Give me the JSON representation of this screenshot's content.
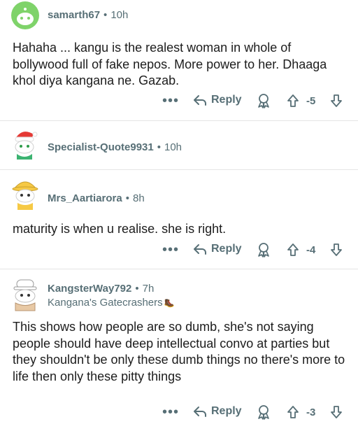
{
  "comments": [
    {
      "username": "samarth67",
      "time": "10h",
      "flair": "",
      "text": "Hahaha ... kangu is the realest woman in whole of bollywood full of fake nepos. More power to her. Dhaaga khol diya kangana ne. Gazab.",
      "reply_label": "Reply",
      "score": "-5",
      "avatar": "snoo-green-avatar"
    },
    {
      "username": "Specialist-Quote9931",
      "time": "10h",
      "flair": "",
      "text": "",
      "reply_label": "",
      "score": "",
      "avatar": "snoo-santa-hat-avatar"
    },
    {
      "username": "Mrs_Aartiarora",
      "time": "8h",
      "flair": "",
      "text": "maturity is when u realise. she is right.",
      "reply_label": "Reply",
      "score": "-4",
      "avatar": "snoo-yellow-hat-avatar"
    },
    {
      "username": "KangsterWay792",
      "time": "7h",
      "flair": "Kangana's Gatecrashers",
      "text": "This shows how people are so dumb, she's not saying people should have deep intellectual convo at parties but they shouldn't be only these dumb things no there's more to life then only these pitty things",
      "reply_label": "Reply",
      "score": "-3",
      "avatar": "snoo-cap-avatar"
    }
  ],
  "colors": {
    "meta": "#576f76",
    "text": "#1c1c1c",
    "divider": "#e5e5e5"
  }
}
